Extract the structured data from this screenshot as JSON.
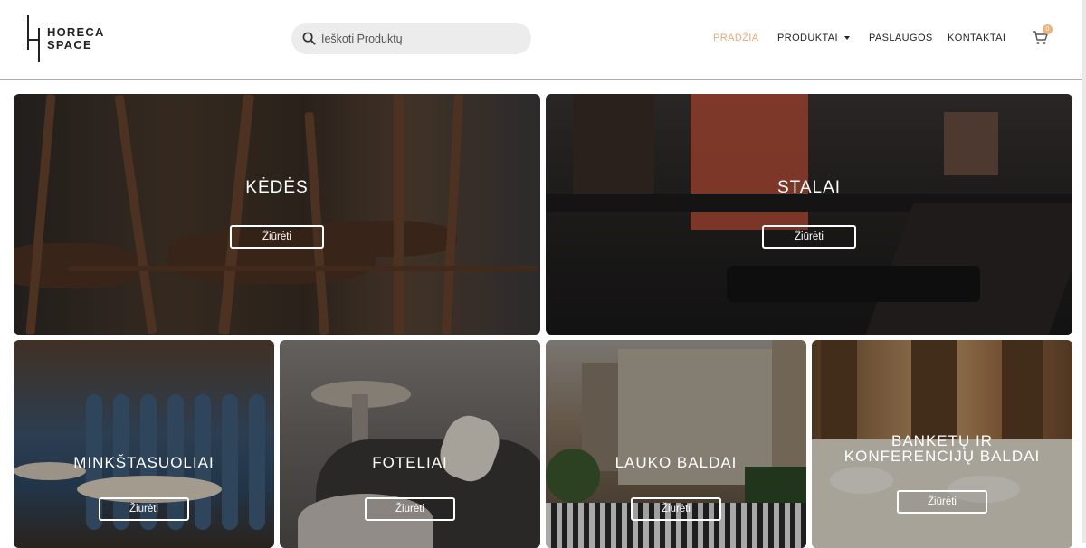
{
  "brand": {
    "line1": "HORECA",
    "line2": "SPACE"
  },
  "search": {
    "placeholder": "Ieškoti Produktų"
  },
  "nav": [
    {
      "label": "PRADŽIA",
      "active": true
    },
    {
      "label": "PRODUKTAI",
      "dropdown": true
    },
    {
      "label": "PASLAUGOS"
    },
    {
      "label": "KONTAKTAI"
    }
  ],
  "cart": {
    "count": "0"
  },
  "tiles": [
    {
      "title": "KĖDĖS",
      "button": "Žiūrėti"
    },
    {
      "title": "STALAI",
      "button": "Žiūrėti"
    },
    {
      "title": "MINKŠTASUOLIAI",
      "button": "Žiūrėti"
    },
    {
      "title": "FOTELIAI",
      "button": "Žiūrėti"
    },
    {
      "title": "LAUKO BALDAI",
      "button": "Žiūrėti"
    },
    {
      "title": "BANKETŲ IR KONFERENCIJŲ BALDAI",
      "button": "Žiūrėti"
    }
  ],
  "colors": {
    "accent": "#e8a87c",
    "badge": "#f0b27a",
    "text": "#222222"
  }
}
